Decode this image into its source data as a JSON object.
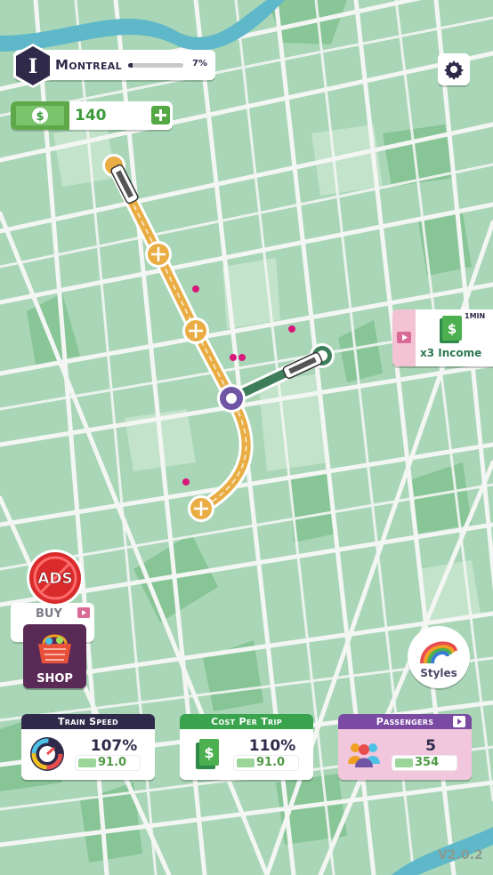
{
  "city": {
    "name": "Montreal",
    "level": "I",
    "progress_text": "7%",
    "progress_value": 0.07
  },
  "money": {
    "value": "140"
  },
  "income_offer": {
    "time": "1MIN",
    "label": "x3 Income"
  },
  "buttons": {
    "ads": "ADS",
    "buy": "BUY",
    "shop": "SHOP",
    "styles": "Styles"
  },
  "stats": {
    "train_speed": {
      "title": "Train Speed",
      "value": "107%",
      "price": "91.0"
    },
    "cost_per_trip": {
      "title": "Cost Per Trip",
      "value": "110%",
      "price": "91.0"
    },
    "passengers": {
      "title": "Passengers",
      "value": "5",
      "price": "354"
    }
  },
  "version": "V2.0.2",
  "colors": {
    "map_bg": "#a9d6b7",
    "road": "#f4f6f4",
    "park": "#7fc08f",
    "water": "#5fb8c9",
    "orange_line": "#e9ad44",
    "green_line": "#3d7d5a",
    "hub": "#6f55a3",
    "passenger_dot": "#d8187a",
    "train_speed_head": "#2f2a4a",
    "cost_head": "#3aa34e",
    "passengers_head": "#7b4aa3"
  },
  "icons": {
    "level": "hexagon-level-icon",
    "settings": "gear-icon",
    "money": "dollar-bill-icon",
    "add": "plus-icon",
    "video": "video-ad-icon",
    "speed": "speedometer-icon",
    "cost": "dollar-stack-icon",
    "passengers": "people-icon",
    "shop": "basket-icon",
    "styles": "rainbow-track-icon"
  }
}
